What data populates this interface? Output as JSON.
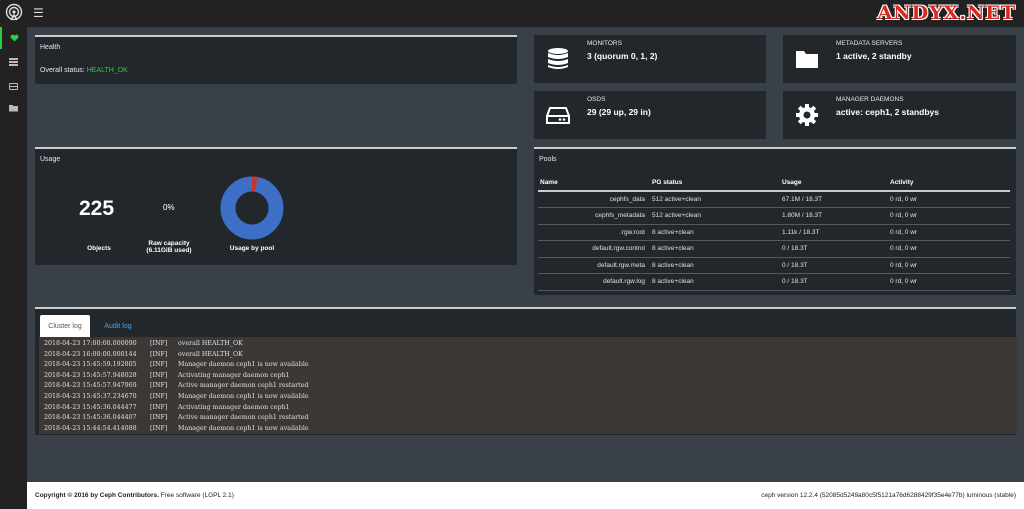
{
  "brand": {
    "watermark": "ANDYX.NET"
  },
  "sidebar": {
    "items": [
      {
        "name": "health",
        "icon": "heartbeat-icon"
      },
      {
        "name": "cluster",
        "icon": "server-icon"
      },
      {
        "name": "block",
        "icon": "hdd-icon"
      },
      {
        "name": "filesystems",
        "icon": "folder-icon"
      }
    ]
  },
  "health": {
    "title": "Health",
    "status_label": "Overall status:",
    "status_value": "HEALTH_OK"
  },
  "cards": {
    "monitors": {
      "title": "MONITORS",
      "value": "3 (quorum 0, 1, 2)"
    },
    "metadata": {
      "title": "METADATA SERVERS",
      "value": "1 active, 2 standby"
    },
    "osds": {
      "title": "OSDS",
      "value": "29 (29 up, 29 in)"
    },
    "managers": {
      "title": "MANAGER DAEMONS",
      "value": "active: ceph1, 2 standbys"
    }
  },
  "usage": {
    "title": "Usage",
    "objects_value": "225",
    "objects_label": "Objects",
    "raw_value": "0%",
    "raw_label": "Raw capacity",
    "raw_sub": "(6.11GiB used)",
    "pool_label": "Usage by pool",
    "donut_primary_color": "#3c6fc5",
    "donut_secondary_color": "#c0392b",
    "donut_secondary_fraction": 0.03
  },
  "pools": {
    "title": "Pools",
    "columns": [
      "Name",
      "PG status",
      "Usage",
      "Activity"
    ],
    "rows": [
      {
        "name": "cephfs_data",
        "pg": "512 active+clean",
        "usage": "67.1M / 18.3T",
        "activity": "0 rd, 0 wr"
      },
      {
        "name": "cephfs_metadata",
        "pg": "512 active+clean",
        "usage": "1.80M / 18.3T",
        "activity": "0 rd, 0 wr"
      },
      {
        "name": ".rgw.root",
        "pg": "8 active+clean",
        "usage": "1.11k / 18.3T",
        "activity": "0 rd, 0 wr"
      },
      {
        "name": "default.rgw.control",
        "pg": "8 active+clean",
        "usage": "0 / 18.3T",
        "activity": "0 rd, 0 wr"
      },
      {
        "name": "default.rgw.meta",
        "pg": "8 active+clean",
        "usage": "0 / 18.3T",
        "activity": "0 rd, 0 wr"
      },
      {
        "name": "default.rgw.log",
        "pg": "8 active+clean",
        "usage": "0 / 18.3T",
        "activity": "0 rd, 0 wr"
      }
    ]
  },
  "log": {
    "tabs": [
      "Cluster log",
      "Audit log"
    ],
    "lines": [
      {
        "time": "2018-04-23 17:00:00.000090",
        "level": "[INF]",
        "msg": "overall HEALTH_OK"
      },
      {
        "time": "2018-04-23 16:00:00.000144",
        "level": "[INF]",
        "msg": "overall HEALTH_OK"
      },
      {
        "time": "2018-04-23 15:45:59.192805",
        "level": "[INF]",
        "msg": "Manager daemon ceph1 is now available"
      },
      {
        "time": "2018-04-23 15:45:57.948028",
        "level": "[INF]",
        "msg": "Activating manager daemon ceph1"
      },
      {
        "time": "2018-04-23 15:45:57.947969",
        "level": "[INF]",
        "msg": "Active manager daemon ceph1 restarted"
      },
      {
        "time": "2018-04-23 15:45:37.234670",
        "level": "[INF]",
        "msg": "Manager daemon ceph1 is now available"
      },
      {
        "time": "2018-04-23 15:45:36.044477",
        "level": "[INF]",
        "msg": "Activating manager daemon ceph1"
      },
      {
        "time": "2018-04-23 15:45:36.044407",
        "level": "[INF]",
        "msg": "Active manager daemon ceph1 restarted"
      },
      {
        "time": "2018-04-23 15:44:54.414088",
        "level": "[INF]",
        "msg": "Manager daemon ceph1 is now available"
      }
    ]
  },
  "footer": {
    "copyright": "Copyright © 2016 by Ceph Contributors.",
    "license": "Free software (LGPL 2.1)",
    "version": "ceph version 12.2.4 (52085d5249a80c5f5121a76d6288429f35e4e77b) luminous (stable)"
  }
}
